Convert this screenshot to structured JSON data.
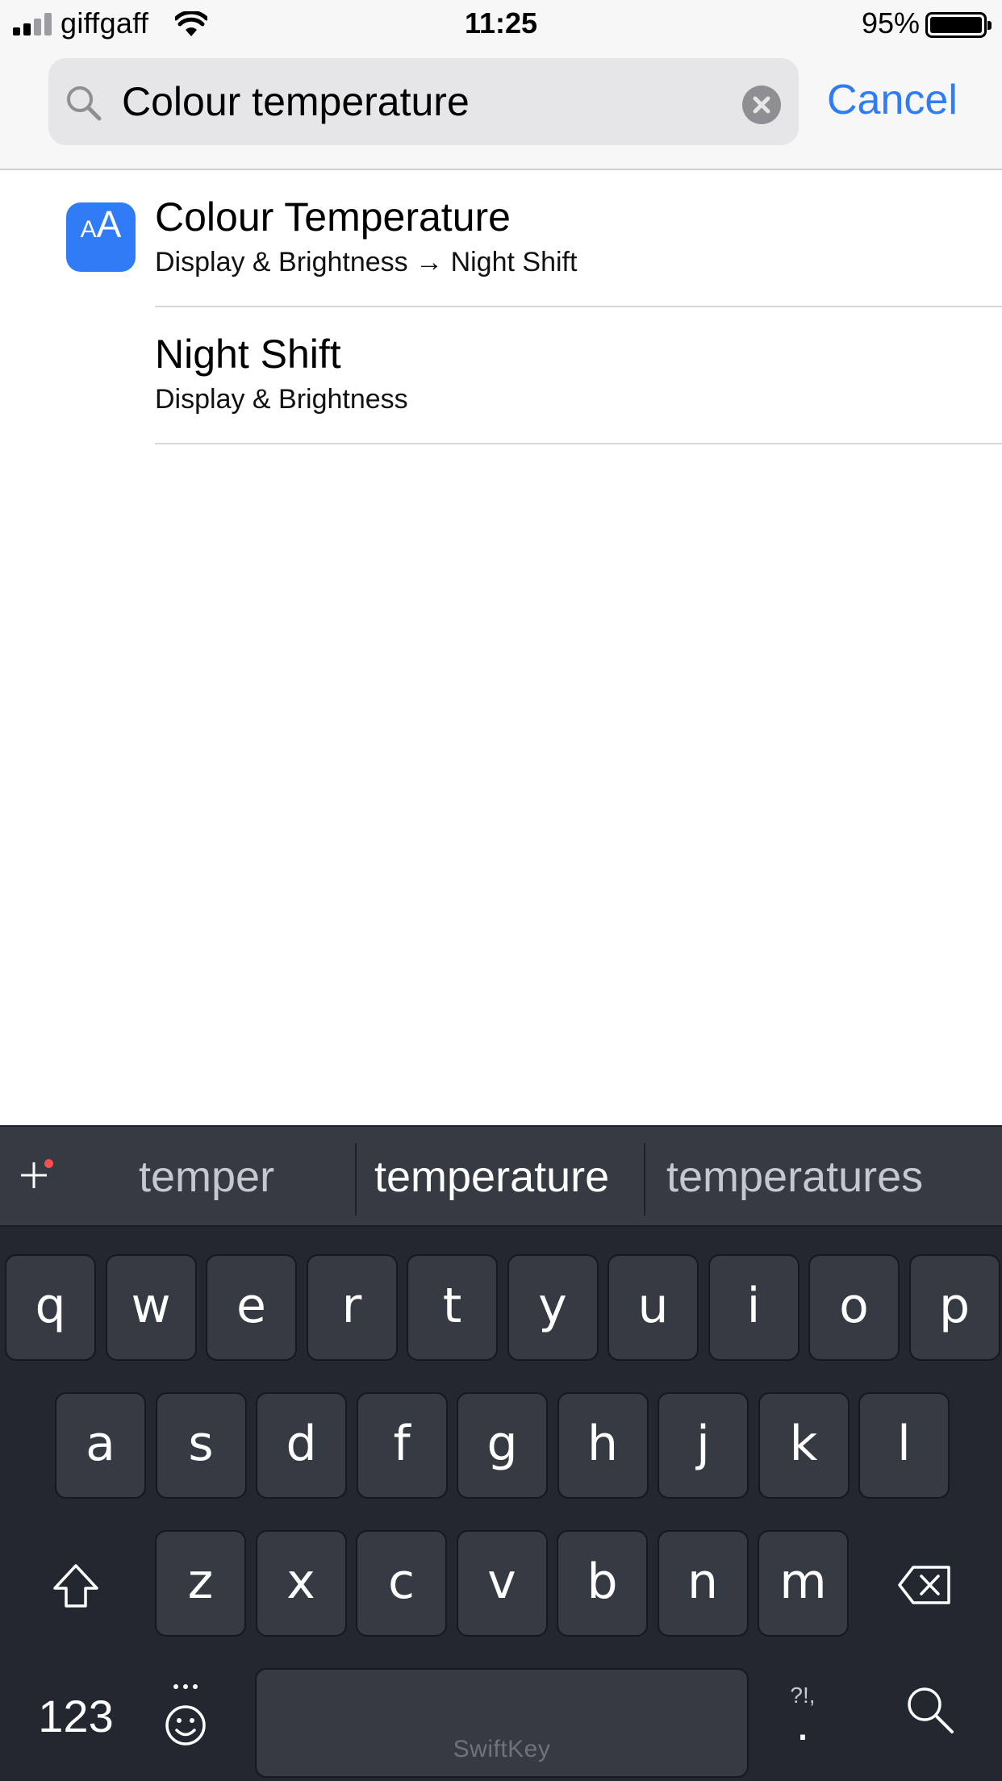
{
  "status_bar": {
    "carrier": "giffgaff",
    "time": "11:25",
    "battery": "95%"
  },
  "search": {
    "query": "Colour temperature",
    "cancel_label": "Cancel"
  },
  "results": [
    {
      "title": "Colour Temperature",
      "subtitle": "Display & Brightness → Night Shift",
      "icon": "text-size-icon",
      "icon_small": "A",
      "icon_big": "A"
    },
    {
      "title": "Night Shift",
      "subtitle": "Display & Brightness"
    }
  ],
  "keyboard": {
    "predictions": [
      "temper",
      "temperature",
      "temperatures"
    ],
    "rows": [
      [
        "q",
        "w",
        "e",
        "r",
        "t",
        "y",
        "u",
        "i",
        "o",
        "p"
      ],
      [
        "a",
        "s",
        "d",
        "f",
        "g",
        "h",
        "j",
        "k",
        "l"
      ],
      [
        "z",
        "x",
        "c",
        "v",
        "b",
        "n",
        "m"
      ]
    ],
    "numbers_label": "123",
    "punct_top": "?!,",
    "punct_bottom": ".",
    "brand": "SwiftKey"
  },
  "colors": {
    "accent": "#2f7cf6",
    "keyboard_bg": "#23272f",
    "key_bg": "#363a42"
  }
}
